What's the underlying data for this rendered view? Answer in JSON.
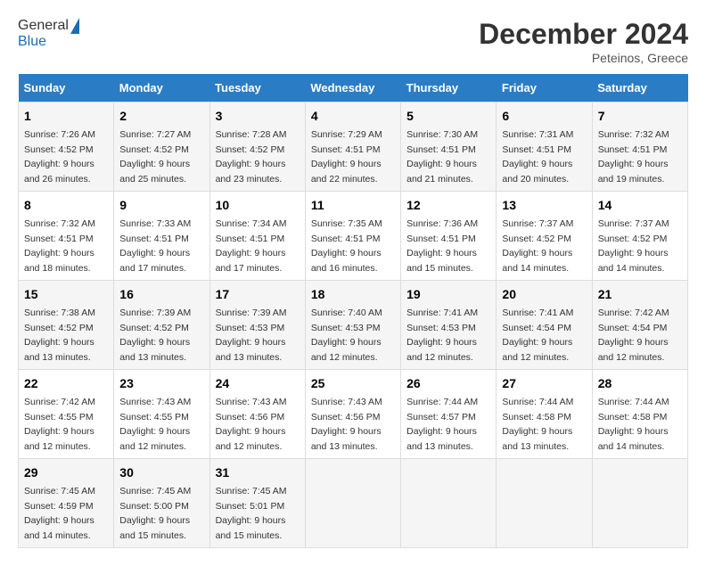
{
  "header": {
    "logo_general": "General",
    "logo_blue": "Blue",
    "month_title": "December 2024",
    "location": "Peteinos, Greece"
  },
  "days_of_week": [
    "Sunday",
    "Monday",
    "Tuesday",
    "Wednesday",
    "Thursday",
    "Friday",
    "Saturday"
  ],
  "weeks": [
    [
      {
        "day": "1",
        "sunrise": "7:26 AM",
        "sunset": "4:52 PM",
        "daylight_hours": "9",
        "daylight_minutes": "26"
      },
      {
        "day": "2",
        "sunrise": "7:27 AM",
        "sunset": "4:52 PM",
        "daylight_hours": "9",
        "daylight_minutes": "25"
      },
      {
        "day": "3",
        "sunrise": "7:28 AM",
        "sunset": "4:52 PM",
        "daylight_hours": "9",
        "daylight_minutes": "23"
      },
      {
        "day": "4",
        "sunrise": "7:29 AM",
        "sunset": "4:51 PM",
        "daylight_hours": "9",
        "daylight_minutes": "22"
      },
      {
        "day": "5",
        "sunrise": "7:30 AM",
        "sunset": "4:51 PM",
        "daylight_hours": "9",
        "daylight_minutes": "21"
      },
      {
        "day": "6",
        "sunrise": "7:31 AM",
        "sunset": "4:51 PM",
        "daylight_hours": "9",
        "daylight_minutes": "20"
      },
      {
        "day": "7",
        "sunrise": "7:32 AM",
        "sunset": "4:51 PM",
        "daylight_hours": "9",
        "daylight_minutes": "19"
      }
    ],
    [
      {
        "day": "8",
        "sunrise": "7:32 AM",
        "sunset": "4:51 PM",
        "daylight_hours": "9",
        "daylight_minutes": "18"
      },
      {
        "day": "9",
        "sunrise": "7:33 AM",
        "sunset": "4:51 PM",
        "daylight_hours": "9",
        "daylight_minutes": "17"
      },
      {
        "day": "10",
        "sunrise": "7:34 AM",
        "sunset": "4:51 PM",
        "daylight_hours": "9",
        "daylight_minutes": "17"
      },
      {
        "day": "11",
        "sunrise": "7:35 AM",
        "sunset": "4:51 PM",
        "daylight_hours": "9",
        "daylight_minutes": "16"
      },
      {
        "day": "12",
        "sunrise": "7:36 AM",
        "sunset": "4:51 PM",
        "daylight_hours": "9",
        "daylight_minutes": "15"
      },
      {
        "day": "13",
        "sunrise": "7:37 AM",
        "sunset": "4:52 PM",
        "daylight_hours": "9",
        "daylight_minutes": "14"
      },
      {
        "day": "14",
        "sunrise": "7:37 AM",
        "sunset": "4:52 PM",
        "daylight_hours": "9",
        "daylight_minutes": "14"
      }
    ],
    [
      {
        "day": "15",
        "sunrise": "7:38 AM",
        "sunset": "4:52 PM",
        "daylight_hours": "9",
        "daylight_minutes": "13"
      },
      {
        "day": "16",
        "sunrise": "7:39 AM",
        "sunset": "4:52 PM",
        "daylight_hours": "9",
        "daylight_minutes": "13"
      },
      {
        "day": "17",
        "sunrise": "7:39 AM",
        "sunset": "4:53 PM",
        "daylight_hours": "9",
        "daylight_minutes": "13"
      },
      {
        "day": "18",
        "sunrise": "7:40 AM",
        "sunset": "4:53 PM",
        "daylight_hours": "9",
        "daylight_minutes": "12"
      },
      {
        "day": "19",
        "sunrise": "7:41 AM",
        "sunset": "4:53 PM",
        "daylight_hours": "9",
        "daylight_minutes": "12"
      },
      {
        "day": "20",
        "sunrise": "7:41 AM",
        "sunset": "4:54 PM",
        "daylight_hours": "9",
        "daylight_minutes": "12"
      },
      {
        "day": "21",
        "sunrise": "7:42 AM",
        "sunset": "4:54 PM",
        "daylight_hours": "9",
        "daylight_minutes": "12"
      }
    ],
    [
      {
        "day": "22",
        "sunrise": "7:42 AM",
        "sunset": "4:55 PM",
        "daylight_hours": "9",
        "daylight_minutes": "12"
      },
      {
        "day": "23",
        "sunrise": "7:43 AM",
        "sunset": "4:55 PM",
        "daylight_hours": "9",
        "daylight_minutes": "12"
      },
      {
        "day": "24",
        "sunrise": "7:43 AM",
        "sunset": "4:56 PM",
        "daylight_hours": "9",
        "daylight_minutes": "12"
      },
      {
        "day": "25",
        "sunrise": "7:43 AM",
        "sunset": "4:56 PM",
        "daylight_hours": "9",
        "daylight_minutes": "13"
      },
      {
        "day": "26",
        "sunrise": "7:44 AM",
        "sunset": "4:57 PM",
        "daylight_hours": "9",
        "daylight_minutes": "13"
      },
      {
        "day": "27",
        "sunrise": "7:44 AM",
        "sunset": "4:58 PM",
        "daylight_hours": "9",
        "daylight_minutes": "13"
      },
      {
        "day": "28",
        "sunrise": "7:44 AM",
        "sunset": "4:58 PM",
        "daylight_hours": "9",
        "daylight_minutes": "14"
      }
    ],
    [
      {
        "day": "29",
        "sunrise": "7:45 AM",
        "sunset": "4:59 PM",
        "daylight_hours": "9",
        "daylight_minutes": "14"
      },
      {
        "day": "30",
        "sunrise": "7:45 AM",
        "sunset": "5:00 PM",
        "daylight_hours": "9",
        "daylight_minutes": "15"
      },
      {
        "day": "31",
        "sunrise": "7:45 AM",
        "sunset": "5:01 PM",
        "daylight_hours": "9",
        "daylight_minutes": "15"
      },
      null,
      null,
      null,
      null
    ]
  ],
  "labels": {
    "sunrise": "Sunrise:",
    "sunset": "Sunset:",
    "daylight": "Daylight:",
    "hours_suffix": "hours",
    "and": "and",
    "minutes_suffix": "minutes."
  }
}
